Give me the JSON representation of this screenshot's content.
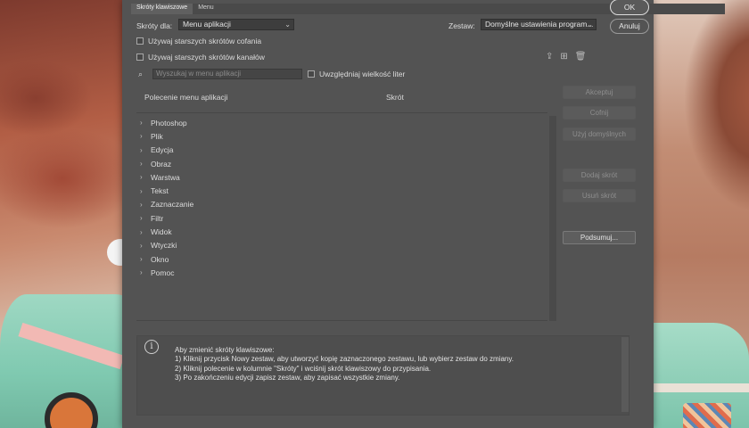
{
  "dialog": {
    "tabs": [
      "Skróty klawiszowe",
      "Menu"
    ],
    "ok_label": "OK",
    "cancel_label": "Anuluj"
  },
  "shortcuts_for": {
    "label": "Skróty dla:",
    "value": "Menu aplikacji"
  },
  "set": {
    "label": "Zestaw:",
    "value": "Domyślne ustawienia program..."
  },
  "options": {
    "legacy_undo": "Używaj starszych skrótów cofania",
    "legacy_channel": "Używaj starszych skrótów kanałów",
    "match_case": "Uwzględniaj wielkość liter"
  },
  "search": {
    "placeholder": "Wyszukaj w menu aplikacji"
  },
  "table": {
    "col_command": "Polecenie menu aplikacji",
    "col_shortcut": "Skrót"
  },
  "tree_items": [
    "Photoshop",
    "Plik",
    "Edycja",
    "Obraz",
    "Warstwa",
    "Tekst",
    "Zaznaczanie",
    "Filtr",
    "Widok",
    "Wtyczki",
    "Okno",
    "Pomoc"
  ],
  "side_buttons": {
    "accept": "Akceptuj",
    "undo": "Cofnij",
    "use_default": "Użyj domyślnych",
    "add_shortcut": "Dodaj skrót",
    "remove_shortcut": "Usuń skrót",
    "summarize": "Podsumuj..."
  },
  "info": {
    "line1": "Aby zmienić skróty klawiszowe:",
    "line2": "1) Kliknij przycisk Nowy zestaw, aby utworzyć kopię zaznaczonego zestawu, lub wybierz zestaw do zmiany.",
    "line3": "2) Kliknij polecenie w kolumnie \"Skróty\" i wciśnij skrót klawiszowy do przypisania.",
    "line4": "3) Po zakończeniu edycji zapisz zestaw, aby zapisać wszystkie zmiany."
  },
  "icons": {
    "info": "info-icon",
    "search": "search-icon",
    "save_set": "save-set-icon",
    "new_set": "new-set-icon",
    "delete_set": "trash-icon"
  }
}
